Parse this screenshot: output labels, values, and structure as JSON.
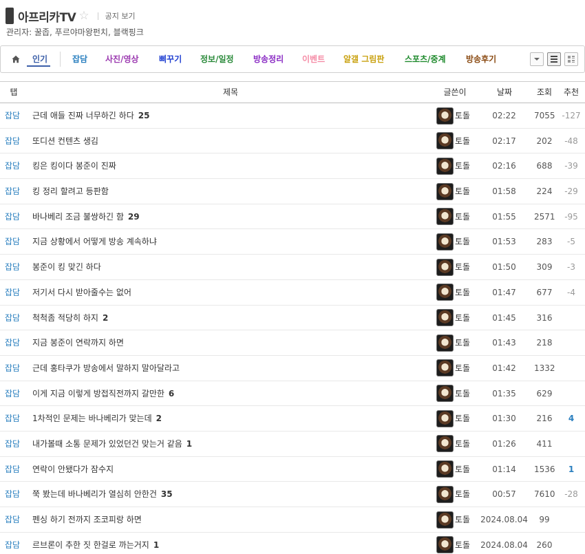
{
  "gallery": {
    "title": "아프리카TV",
    "star": "☆",
    "notice_button": "공지 보기",
    "managers": "관리자: 꿀좁, 푸르야마왕펀치, 블랙핑크"
  },
  "tabs": {
    "home_icon": "home-icon",
    "items": [
      {
        "label": "인기",
        "color": "#3b5ea8"
      },
      {
        "label": "잡담",
        "color": "#2a7fbf"
      },
      {
        "label": "사진/영상",
        "color": "#9b39b0"
      },
      {
        "label": "삐꾸기",
        "color": "#1f3fd1"
      },
      {
        "label": "정보/일정",
        "color": "#2a8a3a"
      },
      {
        "label": "방송정리",
        "color": "#8a2bc4"
      },
      {
        "label": "이벤트",
        "color": "#f58ca6"
      },
      {
        "label": "알갤 그림판",
        "color": "#c9a10f"
      },
      {
        "label": "스포츠/중계",
        "color": "#1e8a2c"
      },
      {
        "label": "방송후기",
        "color": "#8a4a12"
      }
    ]
  },
  "table": {
    "headers": {
      "tab": "탭",
      "title": "제목",
      "writer": "글쓴이",
      "date": "날짜",
      "views": "조회",
      "recommend": "추천"
    },
    "rows": [
      {
        "tab": "잡담",
        "title": "근데 애들 진짜 너무하긴 하다",
        "comments": "25",
        "writer": "토돌",
        "date": "02:22",
        "views": "7055",
        "rec": "-127"
      },
      {
        "tab": "잡담",
        "title": "또디션 컨텐츠 생김",
        "comments": "",
        "writer": "토돌",
        "date": "02:17",
        "views": "202",
        "rec": "-48"
      },
      {
        "tab": "잡담",
        "title": "킹은 킹이다 봉준이 진짜",
        "comments": "",
        "writer": "토돌",
        "date": "02:16",
        "views": "688",
        "rec": "-39"
      },
      {
        "tab": "잡담",
        "title": "킹 정리 할려고 등판함",
        "comments": "",
        "writer": "토돌",
        "date": "01:58",
        "views": "224",
        "rec": "-29"
      },
      {
        "tab": "잡담",
        "title": "바나베리 조금 불쌍하긴 함",
        "comments": "29",
        "writer": "토돌",
        "date": "01:55",
        "views": "2571",
        "rec": "-95"
      },
      {
        "tab": "잡담",
        "title": "지금 상황에서 어떻게 방송 계속하냐",
        "comments": "",
        "writer": "토돌",
        "date": "01:53",
        "views": "283",
        "rec": "-5"
      },
      {
        "tab": "잡담",
        "title": "봉준이 킹 맞긴 하다",
        "comments": "",
        "writer": "토돌",
        "date": "01:50",
        "views": "309",
        "rec": "-3"
      },
      {
        "tab": "잡담",
        "title": "저기서 다시 받아줄수는 없어",
        "comments": "",
        "writer": "토돌",
        "date": "01:47",
        "views": "677",
        "rec": "-4"
      },
      {
        "tab": "잡담",
        "title": "척척좀 적당히 하지",
        "comments": "2",
        "writer": "토돌",
        "date": "01:45",
        "views": "316",
        "rec": ""
      },
      {
        "tab": "잡담",
        "title": "지금 봉준이 연락까지 하면",
        "comments": "",
        "writer": "토돌",
        "date": "01:43",
        "views": "218",
        "rec": ""
      },
      {
        "tab": "잡담",
        "title": "근데 홍타쿠가 방송에서 말하지 말아달라고",
        "comments": "",
        "writer": "토돌",
        "date": "01:42",
        "views": "1332",
        "rec": ""
      },
      {
        "tab": "잡담",
        "title": "이게 지금 이렇게 방접직전까지 갈만한",
        "comments": "6",
        "writer": "토돌",
        "date": "01:35",
        "views": "629",
        "rec": ""
      },
      {
        "tab": "잡담",
        "title": "1차적인 문제는 바나베리가 맞는데",
        "comments": "2",
        "writer": "토돌",
        "date": "01:30",
        "views": "216",
        "rec": "4"
      },
      {
        "tab": "잡담",
        "title": "내가볼때 소통 문제가 있었던건 맞는거 같음",
        "comments": "1",
        "writer": "토돌",
        "date": "01:26",
        "views": "411",
        "rec": ""
      },
      {
        "tab": "잡담",
        "title": "연락이 안됐다가 잠수지",
        "comments": "",
        "writer": "토돌",
        "date": "01:14",
        "views": "1536",
        "rec": "1"
      },
      {
        "tab": "잡담",
        "title": "쭉 봤는데 바나베리가 열심히 안한건",
        "comments": "35",
        "writer": "토돌",
        "date": "00:57",
        "views": "7610",
        "rec": "-28"
      },
      {
        "tab": "잡담",
        "title": "펜싱 하기 전까지 조코피랑 하면",
        "comments": "",
        "writer": "토돌",
        "date": "2024.08.04",
        "views": "99",
        "rec": ""
      },
      {
        "tab": "잡담",
        "title": "르브론이 추한 짓 한걸로 까는거지",
        "comments": "1",
        "writer": "토돌",
        "date": "2024.08.04",
        "views": "260",
        "rec": ""
      }
    ]
  }
}
